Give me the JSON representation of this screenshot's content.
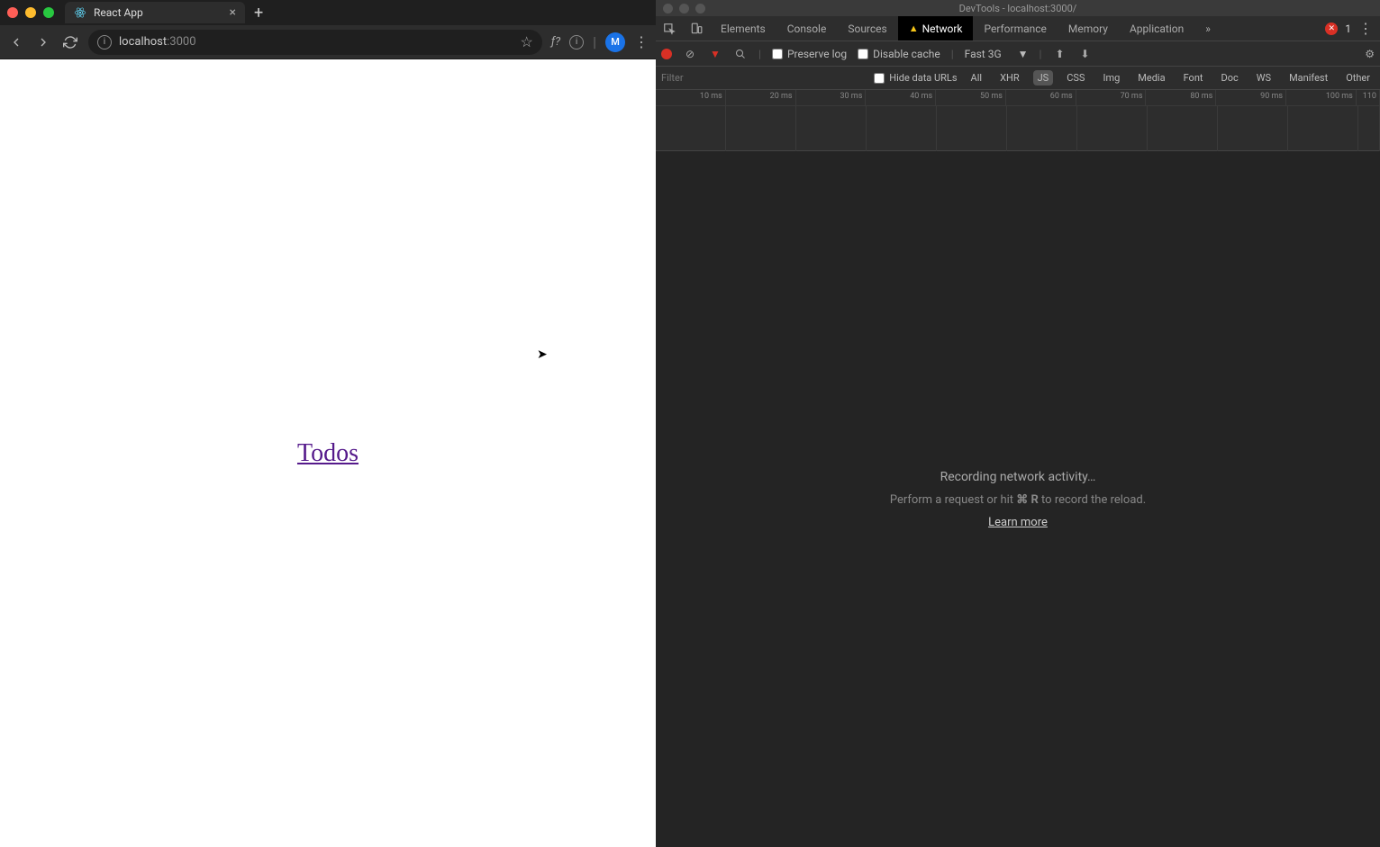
{
  "browser": {
    "tab": {
      "title": "React App"
    },
    "url_host": "localhost",
    "url_port": ":3000",
    "profile_initial": "M"
  },
  "page": {
    "link_text": "Todos"
  },
  "devtools": {
    "title": "DevTools - localhost:3000/",
    "tabs": [
      "Elements",
      "Console",
      "Sources",
      "Network",
      "Performance",
      "Memory",
      "Application"
    ],
    "error_count": "1",
    "toolbar": {
      "preserve_log": "Preserve log",
      "disable_cache": "Disable cache",
      "throttle": "Fast 3G"
    },
    "filter": {
      "placeholder": "Filter",
      "hide_data_urls": "Hide data URLs",
      "types": [
        "All",
        "XHR",
        "JS",
        "CSS",
        "Img",
        "Media",
        "Font",
        "Doc",
        "WS",
        "Manifest",
        "Other"
      ],
      "active_type": "JS"
    },
    "timeline_ticks": [
      "10 ms",
      "20 ms",
      "30 ms",
      "40 ms",
      "50 ms",
      "60 ms",
      "70 ms",
      "80 ms",
      "90 ms",
      "100 ms",
      "110"
    ],
    "empty": {
      "title": "Recording network activity…",
      "sub_prefix": "Perform a request or hit ",
      "sub_kbd": "⌘ R",
      "sub_suffix": " to record the reload.",
      "learn": "Learn more"
    }
  }
}
